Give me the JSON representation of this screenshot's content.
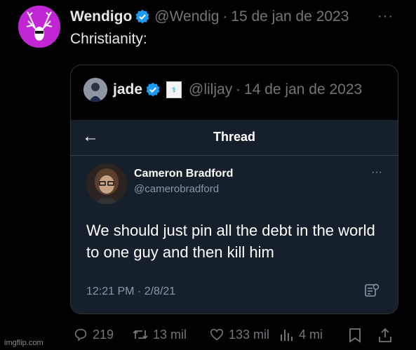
{
  "tweet": {
    "author_name": "Wendigo",
    "handle": "@Wendigo",
    "separator": "·",
    "date": "15 de jan de 2023",
    "more": "···",
    "text": "Christianity:"
  },
  "quote": {
    "author_name": "jade",
    "handle": "@liljay",
    "separator": "·",
    "date": "14 de jan de 2023"
  },
  "embedded": {
    "header_title": "Thread",
    "author_name": "Cameron Bradford",
    "handle": "@camerobradford",
    "more": "···",
    "body": "We should just pin all the debt in the world to one guy and then kill him",
    "timestamp": "12:21 PM · 2/8/21"
  },
  "actions": {
    "replies": "219",
    "retweets": "13 mil",
    "likes": "133 mil",
    "views": "4 mi"
  },
  "watermark": "imgflip.com",
  "colors": {
    "accent": "#1d9bf0",
    "avatar_bg": "#c026d3",
    "embedded_bg": "#15202b"
  }
}
